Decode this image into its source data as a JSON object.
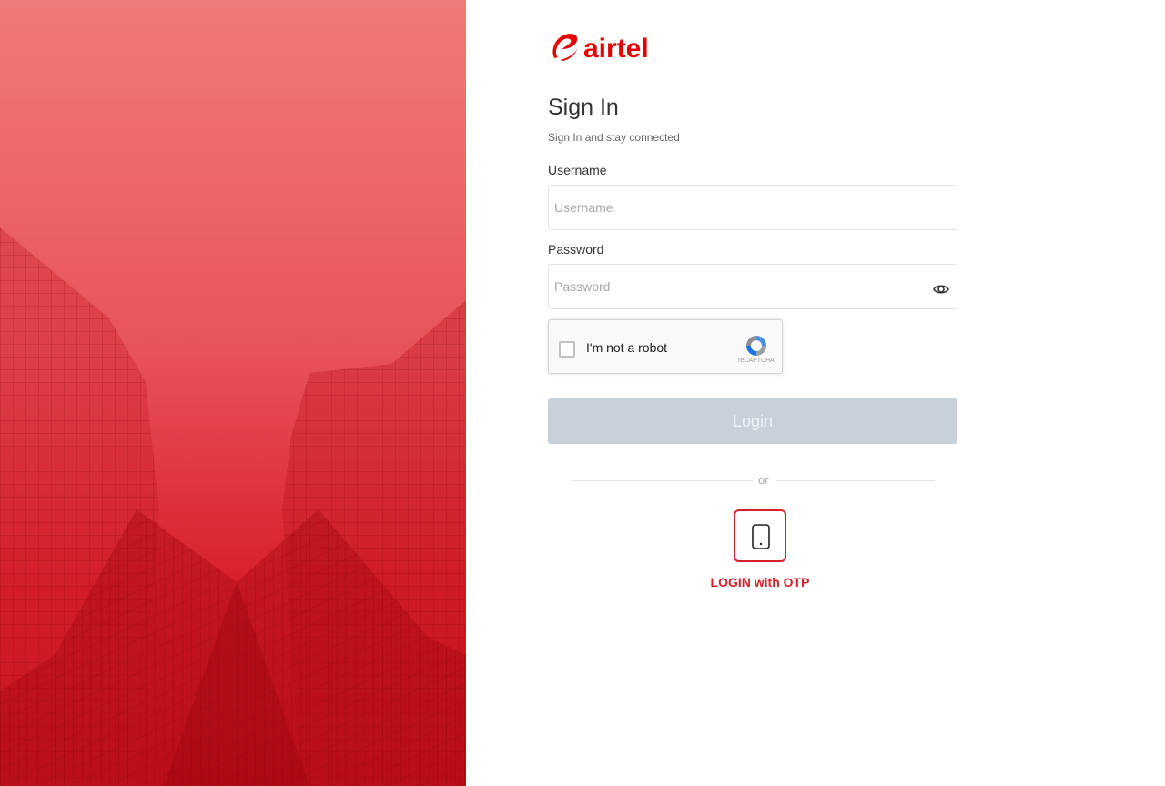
{
  "brand": {
    "name": "airtel",
    "color": "#e40000",
    "logo_icon": "airtel-swirl-icon"
  },
  "signin": {
    "title": "Sign In",
    "subtitle": "Sign In and stay connected"
  },
  "username": {
    "label": "Username",
    "placeholder": "Username",
    "value": ""
  },
  "password": {
    "label": "Password",
    "placeholder": "Password",
    "value": "",
    "toggle_icon": "eye-icon"
  },
  "captcha": {
    "label": "I'm not a robot",
    "brand_text": "reCAPTCHA",
    "checked": false
  },
  "login_button": {
    "label": "Login",
    "enabled": false
  },
  "divider": {
    "text": "or"
  },
  "otp": {
    "label": "LOGIN with OTP",
    "icon": "mobile-phone-icon"
  },
  "colors": {
    "accent": "#d6202b",
    "disabled_button": "#c8d1da"
  }
}
